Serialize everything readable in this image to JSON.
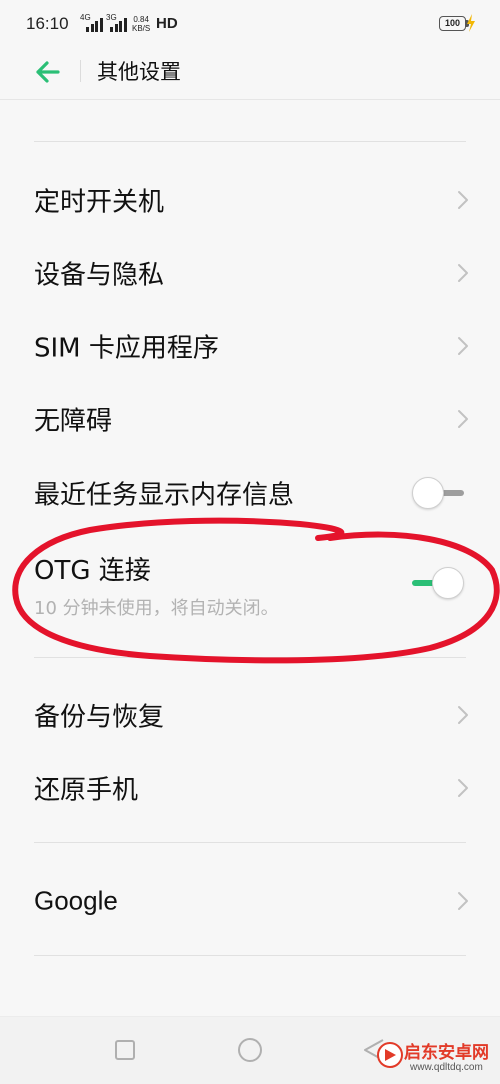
{
  "status_bar": {
    "time": "16:10",
    "sim1_type": "4G",
    "sim2_type": "3G",
    "net_speed_value": "0.84",
    "net_speed_unit": "KB/S",
    "hd_label": "HD",
    "battery_level": "100"
  },
  "header": {
    "title": "其他设置"
  },
  "settings": {
    "timed_power": "定时开关机",
    "device_privacy": "设备与隐私",
    "sim_apps": "SIM 卡应用程序",
    "accessibility": "无障碍",
    "recent_tasks_memory": "最近任务显示内存信息",
    "recent_tasks_memory_on": false,
    "otg_title": "OTG 连接",
    "otg_subtitle": "10 分钟未使用，将自动关闭。",
    "otg_on": true,
    "backup_restore": "备份与恢复",
    "reset_phone": "还原手机",
    "google": "Google"
  },
  "colors": {
    "accent": "#2bbf76",
    "annotation_red": "#e4132b",
    "background": "#f7f7f7"
  },
  "watermark": {
    "name": "启东安卓网",
    "url": "www.qdltdq.com"
  },
  "icons": {
    "back": "arrow-left-icon",
    "chevron": "chevron-right-icon",
    "nav_recent": "square-icon",
    "nav_home": "circle-icon",
    "nav_back": "triangle-icon"
  }
}
